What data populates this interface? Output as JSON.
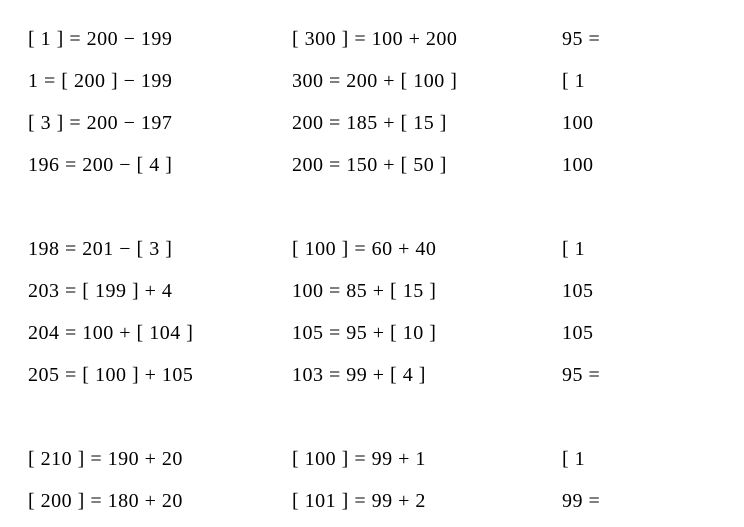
{
  "columns": [
    {
      "groups": [
        [
          "[ 1 ] = 200 − 199",
          "1 = [ 200 ] − 199",
          "[ 3 ] = 200 − 197",
          "196 = 200 − [ 4 ]"
        ],
        [
          "198 = 201 − [ 3 ]",
          "203 = [ 199 ] + 4",
          "204 = 100 + [ 104 ]",
          "205 = [ 100 ] + 105"
        ],
        [
          "[ 210 ] = 190 + 20",
          "[ 200 ] = 180 + 20"
        ]
      ]
    },
    {
      "groups": [
        [
          "[ 300 ] = 100 + 200",
          "300 = 200 + [ 100 ]",
          "200 = 185 + [ 15 ]",
          "200 = 150 + [ 50 ]"
        ],
        [
          "[ 100 ] = 60 + 40",
          "100 = 85 + [ 15 ]",
          "105 = 95 + [ 10 ]",
          "103 = 99 + [ 4 ]"
        ],
        [
          "[ 100 ] = 99 + 1",
          "[ 101 ] = 99 + 2"
        ]
      ]
    },
    {
      "groups": [
        [
          "95 =",
          "[ 1",
          "100",
          "100"
        ],
        [
          "[ 1",
          "105",
          "105",
          "95 ="
        ],
        [
          "[ 1",
          "99 ="
        ]
      ]
    }
  ]
}
